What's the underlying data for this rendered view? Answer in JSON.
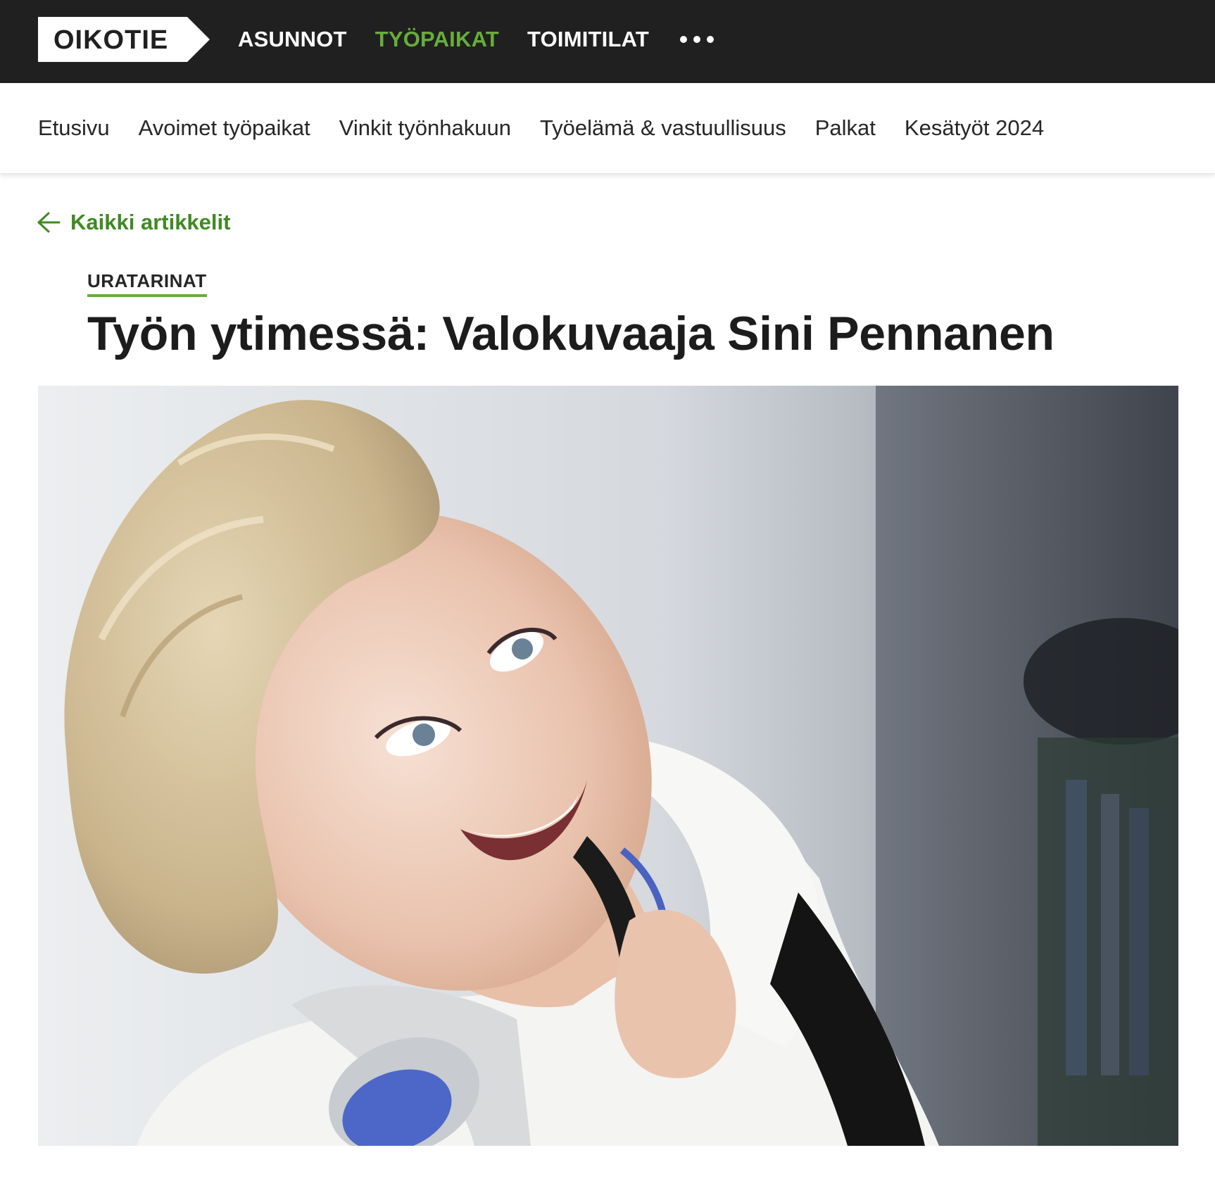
{
  "topbar": {
    "logo_text": "OIKOTIE",
    "nav": [
      {
        "label": "ASUNNOT",
        "active": false
      },
      {
        "label": "TYÖPAIKAT",
        "active": true
      },
      {
        "label": "TOIMITILAT",
        "active": false
      }
    ],
    "more_icon": "more-dots-icon",
    "colors": {
      "background": "#202020",
      "active": "#67ad3c"
    }
  },
  "subnav": {
    "items": [
      {
        "label": "Etusivu"
      },
      {
        "label": "Avoimet työpaikat"
      },
      {
        "label": "Vinkit työnhakuun"
      },
      {
        "label": "Työelämä & vastuullisuus"
      },
      {
        "label": "Palkat"
      },
      {
        "label": "Kesätyöt 2024"
      }
    ]
  },
  "article": {
    "back_label": "Kaikki artikkelit",
    "back_icon": "arrow-left-icon",
    "category": "URATARINAT",
    "title": "Työn ytimessä: Valokuvaaja Sini Pennanen",
    "accent_color": "#3f8a23"
  }
}
